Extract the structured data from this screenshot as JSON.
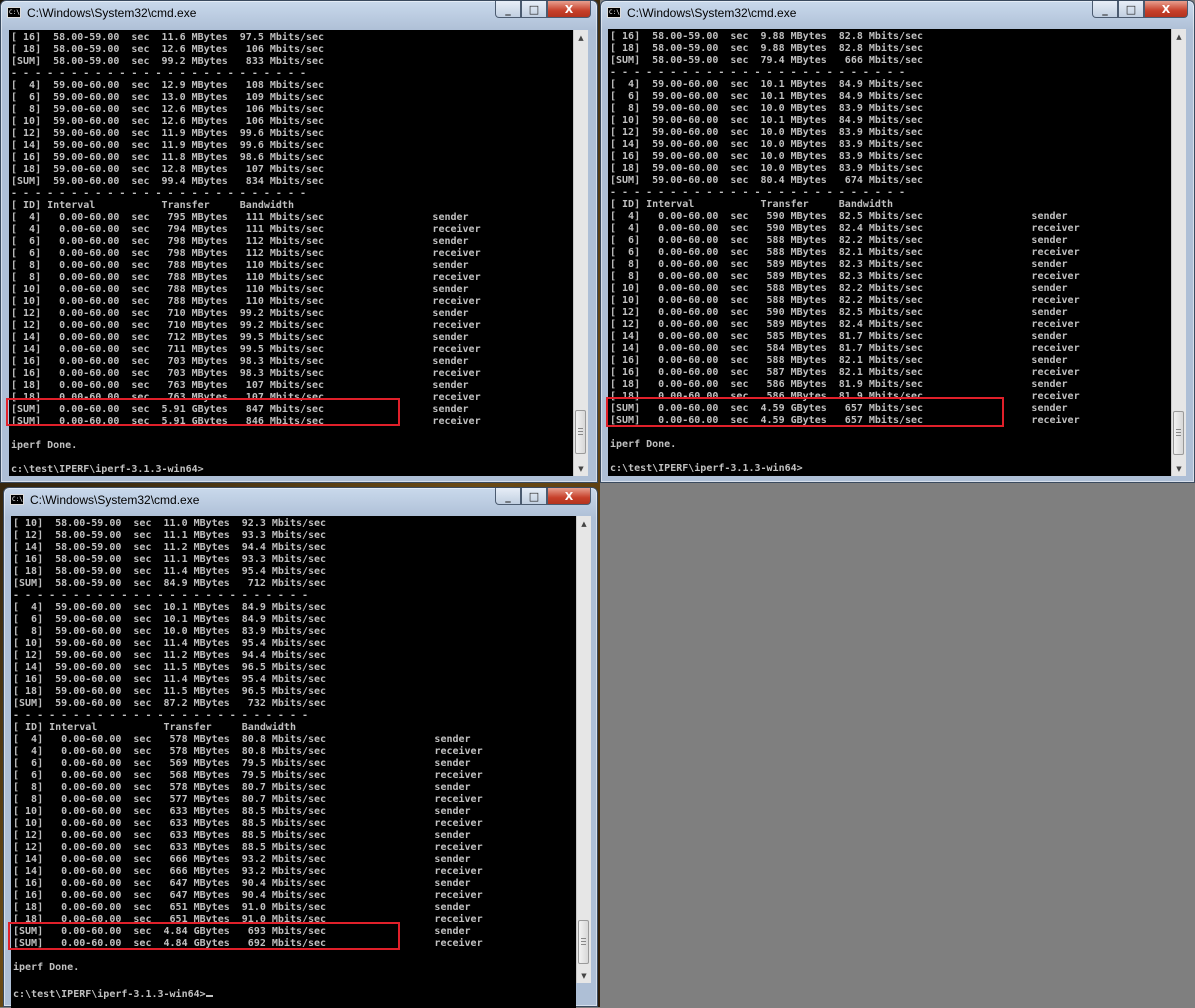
{
  "windows": [
    {
      "title": "C:\\Windows\\System32\\cmd.exe",
      "controls": {
        "minimize": "_",
        "maximize": "□",
        "close": "X"
      },
      "console_text": "[ 16]  58.00-59.00  sec  11.6 MBytes  97.5 Mbits/sec\n[ 18]  58.00-59.00  sec  12.6 MBytes   106 Mbits/sec\n[SUM]  58.00-59.00  sec  99.2 MBytes   833 Mbits/sec\n- - - - - - - - - - - - - - - - - - - - - - - - -\n[  4]  59.00-60.00  sec  12.9 MBytes   108 Mbits/sec\n[  6]  59.00-60.00  sec  13.0 MBytes   109 Mbits/sec\n[  8]  59.00-60.00  sec  12.6 MBytes   106 Mbits/sec\n[ 10]  59.00-60.00  sec  12.6 MBytes   106 Mbits/sec\n[ 12]  59.00-60.00  sec  11.9 MBytes  99.6 Mbits/sec\n[ 14]  59.00-60.00  sec  11.9 MBytes  99.6 Mbits/sec\n[ 16]  59.00-60.00  sec  11.8 MBytes  98.6 Mbits/sec\n[ 18]  59.00-60.00  sec  12.8 MBytes   107 Mbits/sec\n[SUM]  59.00-60.00  sec  99.4 MBytes   834 Mbits/sec\n- - - - - - - - - - - - - - - - - - - - - - - - -\n[ ID] Interval           Transfer     Bandwidth\n[  4]   0.00-60.00  sec   795 MBytes   111 Mbits/sec                  sender\n[  4]   0.00-60.00  sec   794 MBytes   111 Mbits/sec                  receiver\n[  6]   0.00-60.00  sec   798 MBytes   112 Mbits/sec                  sender\n[  6]   0.00-60.00  sec   798 MBytes   112 Mbits/sec                  receiver\n[  8]   0.00-60.00  sec   788 MBytes   110 Mbits/sec                  sender\n[  8]   0.00-60.00  sec   788 MBytes   110 Mbits/sec                  receiver\n[ 10]   0.00-60.00  sec   788 MBytes   110 Mbits/sec                  sender\n[ 10]   0.00-60.00  sec   788 MBytes   110 Mbits/sec                  receiver\n[ 12]   0.00-60.00  sec   710 MBytes  99.2 Mbits/sec                  sender\n[ 12]   0.00-60.00  sec   710 MBytes  99.2 Mbits/sec                  receiver\n[ 14]   0.00-60.00  sec   712 MBytes  99.5 Mbits/sec                  sender\n[ 14]   0.00-60.00  sec   711 MBytes  99.5 Mbits/sec                  receiver\n[ 16]   0.00-60.00  sec   703 MBytes  98.3 Mbits/sec                  sender\n[ 16]   0.00-60.00  sec   703 MBytes  98.3 Mbits/sec                  receiver\n[ 18]   0.00-60.00  sec   763 MBytes   107 Mbits/sec                  sender\n[ 18]   0.00-60.00  sec   763 MBytes   107 Mbits/sec                  receiver\n[SUM]   0.00-60.00  sec  5.91 GBytes   847 Mbits/sec                  sender\n[SUM]   0.00-60.00  sec  5.91 GBytes   846 Mbits/sec                  receiver\n\niperf Done.\n\nc:\\test\\IPERF\\iperf-3.1.3-win64>"
    },
    {
      "title": "C:\\Windows\\System32\\cmd.exe",
      "controls": {
        "minimize": "_",
        "maximize": "□",
        "close": "X"
      },
      "console_text": "[ 16]  58.00-59.00  sec  9.88 MBytes  82.8 Mbits/sec\n[ 18]  58.00-59.00  sec  9.88 MBytes  82.8 Mbits/sec\n[SUM]  58.00-59.00  sec  79.4 MBytes   666 Mbits/sec\n- - - - - - - - - - - - - - - - - - - - - - - - -\n[  4]  59.00-60.00  sec  10.1 MBytes  84.9 Mbits/sec\n[  6]  59.00-60.00  sec  10.1 MBytes  84.9 Mbits/sec\n[  8]  59.00-60.00  sec  10.0 MBytes  83.9 Mbits/sec\n[ 10]  59.00-60.00  sec  10.1 MBytes  84.9 Mbits/sec\n[ 12]  59.00-60.00  sec  10.0 MBytes  83.9 Mbits/sec\n[ 14]  59.00-60.00  sec  10.0 MBytes  83.9 Mbits/sec\n[ 16]  59.00-60.00  sec  10.0 MBytes  83.9 Mbits/sec\n[ 18]  59.00-60.00  sec  10.0 MBytes  83.9 Mbits/sec\n[SUM]  59.00-60.00  sec  80.4 MBytes   674 Mbits/sec\n- - - - - - - - - - - - - - - - - - - - - - - - -\n[ ID] Interval           Transfer     Bandwidth\n[  4]   0.00-60.00  sec   590 MBytes  82.5 Mbits/sec                  sender\n[  4]   0.00-60.00  sec   590 MBytes  82.4 Mbits/sec                  receiver\n[  6]   0.00-60.00  sec   588 MBytes  82.2 Mbits/sec                  sender\n[  6]   0.00-60.00  sec   588 MBytes  82.1 Mbits/sec                  receiver\n[  8]   0.00-60.00  sec   589 MBytes  82.3 Mbits/sec                  sender\n[  8]   0.00-60.00  sec   589 MBytes  82.3 Mbits/sec                  receiver\n[ 10]   0.00-60.00  sec   588 MBytes  82.2 Mbits/sec                  sender\n[ 10]   0.00-60.00  sec   588 MBytes  82.2 Mbits/sec                  receiver\n[ 12]   0.00-60.00  sec   590 MBytes  82.5 Mbits/sec                  sender\n[ 12]   0.00-60.00  sec   589 MBytes  82.4 Mbits/sec                  receiver\n[ 14]   0.00-60.00  sec   585 MBytes  81.7 Mbits/sec                  sender\n[ 14]   0.00-60.00  sec   584 MBytes  81.7 Mbits/sec                  receiver\n[ 16]   0.00-60.00  sec   588 MBytes  82.1 Mbits/sec                  sender\n[ 16]   0.00-60.00  sec   587 MBytes  82.1 Mbits/sec                  receiver\n[ 18]   0.00-60.00  sec   586 MBytes  81.9 Mbits/sec                  sender\n[ 18]   0.00-60.00  sec   586 MBytes  81.9 Mbits/sec                  receiver\n[SUM]   0.00-60.00  sec  4.59 GBytes   657 Mbits/sec                  sender\n[SUM]   0.00-60.00  sec  4.59 GBytes   657 Mbits/sec                  receiver\n\niperf Done.\n\nc:\\test\\IPERF\\iperf-3.1.3-win64>"
    },
    {
      "title": "C:\\Windows\\System32\\cmd.exe",
      "controls": {
        "minimize": "_",
        "maximize": "□",
        "close": "X"
      },
      "console_text": "[ 10]  58.00-59.00  sec  11.0 MBytes  92.3 Mbits/sec\n[ 12]  58.00-59.00  sec  11.1 MBytes  93.3 Mbits/sec\n[ 14]  58.00-59.00  sec  11.2 MBytes  94.4 Mbits/sec\n[ 16]  58.00-59.00  sec  11.1 MBytes  93.3 Mbits/sec\n[ 18]  58.00-59.00  sec  11.4 MBytes  95.4 Mbits/sec\n[SUM]  58.00-59.00  sec  84.9 MBytes   712 Mbits/sec\n- - - - - - - - - - - - - - - - - - - - - - - - -\n[  4]  59.00-60.00  sec  10.1 MBytes  84.9 Mbits/sec\n[  6]  59.00-60.00  sec  10.1 MBytes  84.9 Mbits/sec\n[  8]  59.00-60.00  sec  10.0 MBytes  83.9 Mbits/sec\n[ 10]  59.00-60.00  sec  11.4 MBytes  95.4 Mbits/sec\n[ 12]  59.00-60.00  sec  11.2 MBytes  94.4 Mbits/sec\n[ 14]  59.00-60.00  sec  11.5 MBytes  96.5 Mbits/sec\n[ 16]  59.00-60.00  sec  11.4 MBytes  95.4 Mbits/sec\n[ 18]  59.00-60.00  sec  11.5 MBytes  96.5 Mbits/sec\n[SUM]  59.00-60.00  sec  87.2 MBytes   732 Mbits/sec\n- - - - - - - - - - - - - - - - - - - - - - - - -\n[ ID] Interval           Transfer     Bandwidth\n[  4]   0.00-60.00  sec   578 MBytes  80.8 Mbits/sec                  sender\n[  4]   0.00-60.00  sec   578 MBytes  80.8 Mbits/sec                  receiver\n[  6]   0.00-60.00  sec   569 MBytes  79.5 Mbits/sec                  sender\n[  6]   0.00-60.00  sec   568 MBytes  79.5 Mbits/sec                  receiver\n[  8]   0.00-60.00  sec   578 MBytes  80.7 Mbits/sec                  sender\n[  8]   0.00-60.00  sec   577 MBytes  80.7 Mbits/sec                  receiver\n[ 10]   0.00-60.00  sec   633 MBytes  88.5 Mbits/sec                  sender\n[ 10]   0.00-60.00  sec   633 MBytes  88.5 Mbits/sec                  receiver\n[ 12]   0.00-60.00  sec   633 MBytes  88.5 Mbits/sec                  sender\n[ 12]   0.00-60.00  sec   633 MBytes  88.5 Mbits/sec                  receiver\n[ 14]   0.00-60.00  sec   666 MBytes  93.2 Mbits/sec                  sender\n[ 14]   0.00-60.00  sec   666 MBytes  93.2 Mbits/sec                  receiver\n[ 16]   0.00-60.00  sec   647 MBytes  90.4 Mbits/sec                  sender\n[ 16]   0.00-60.00  sec   647 MBytes  90.4 Mbits/sec                  receiver\n[ 18]   0.00-60.00  sec   651 MBytes  91.0 Mbits/sec                  sender\n[ 18]   0.00-60.00  sec   651 MBytes  91.0 Mbits/sec                  receiver\n[SUM]   0.00-60.00  sec  4.84 GBytes   693 Mbits/sec                  sender\n[SUM]   0.00-60.00  sec  4.84 GBytes   692 Mbits/sec                  receiver\n\niperf Done.\n\nc:\\test\\IPERF\\iperf-3.1.3-win64>"
    }
  ],
  "colors": {
    "highlight": "#e0202a",
    "console_bg": "#000000",
    "console_fg": "#c0c0c0",
    "desktop": "#7f7f7f"
  },
  "icons": [
    "cmd-icon",
    "minimize-icon",
    "maximize-icon",
    "close-icon",
    "scroll-up-icon",
    "scroll-down-icon"
  ]
}
